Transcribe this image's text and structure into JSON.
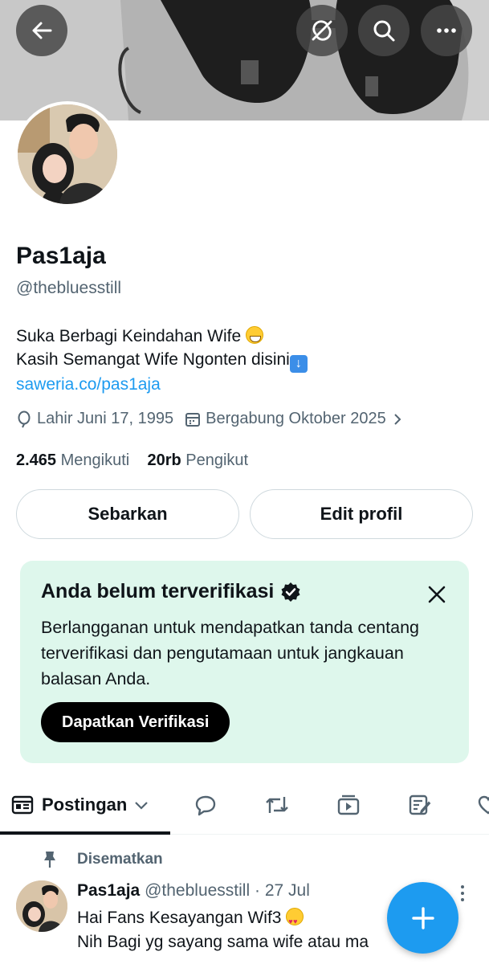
{
  "header": {
    "back_icon": "arrow-left-icon",
    "action_icons": [
      "sync-off-icon",
      "search-icon",
      "more-icon"
    ]
  },
  "profile": {
    "name": "Pas1aja",
    "handle": "@thebluesstill",
    "bio_line1": "Suka  Berbagi Keindahan Wife ",
    "bio_line2": "Kasih Semangat Wife Ngonten disini",
    "link": "saweria.co/pas1aja",
    "birthday": "Lahir Juni 17, 1995",
    "joined": "Bergabung Oktober 2025",
    "following_count": "2.465",
    "following_label": "Mengikuti",
    "followers_count": "20rb",
    "followers_label": "Pengikut"
  },
  "buttons": {
    "share": "Sebarkan",
    "edit": "Edit profil"
  },
  "verify_card": {
    "title": "Anda belum terverifikasi",
    "body": "Berlangganan untuk mendapatkan tanda centang terverifikasi dan pengutamaan untuk jangkauan balasan Anda.",
    "cta": "Dapatkan Verifikasi",
    "bg_color": "#def7ec"
  },
  "tabs": {
    "active_label": "Postingan",
    "icons": [
      "posts-icon",
      "reply-icon",
      "repost-icon",
      "video-icon",
      "article-icon",
      "like-icon"
    ]
  },
  "pinned_post": {
    "pinned_label": "Disematkan",
    "author": "Pas1aja",
    "handle": "@thebluesstill",
    "separator": "·",
    "date": "27 Jul",
    "line1": "Hai Fans Kesayangan Wif3 ",
    "line2": "Nih Bagi yg sayang sama wife atau ma"
  },
  "colors": {
    "accent": "#1d9bf0",
    "text": "#0f1419",
    "secondary": "#536471"
  }
}
